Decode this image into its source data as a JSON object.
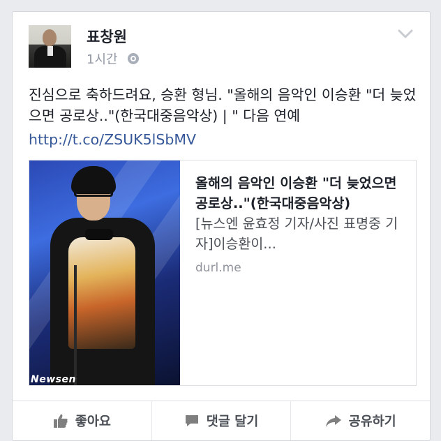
{
  "post": {
    "author": "표창원",
    "time": "1시간",
    "privacy_icon": "globe-icon",
    "text": "진심으로 축하드려요, 승환 형님. \"올해의 음악인 이승환 \"더 늦었으면 공로상..\"(한국대중음악상) | \" 다음 연예",
    "link_url": "http://t.co/ZSUK5lSbMV"
  },
  "link_preview": {
    "title": "올해의 음악인 이승환 \"더 늦었으면 공로상..\"(한국대중음악상)",
    "description": "[뉴스엔 윤효정 기자/사진 표명중 기자]이승환이...",
    "domain": "durl.me",
    "watermark": "Newsen"
  },
  "actions": {
    "like_label": "좋아요",
    "comment_label": "댓글 달기",
    "share_label": "공유하기"
  },
  "colors": {
    "background": "#e9ebee",
    "link": "#365899",
    "text": "#1d2129",
    "muted": "#9197a3"
  }
}
